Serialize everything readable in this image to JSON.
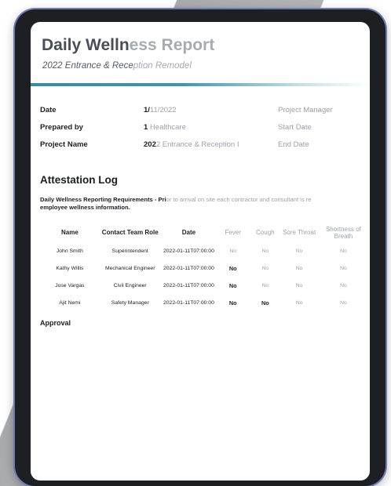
{
  "report": {
    "title_dark": "Daily Welln",
    "title_faded": "ess Report",
    "subtitle_dark": "2022 Entrance & Rece",
    "subtitle_faded": "ption Remodel"
  },
  "info": {
    "rows": [
      {
        "label": "Date",
        "value_dark": "1/",
        "value_faded": "11/2022",
        "label2": "Project Manager"
      },
      {
        "label": "Prepared by",
        "value_dark": "1 ",
        "value_faded": "Healthcare",
        "label2": "Start Date"
      },
      {
        "label": "Project Name",
        "value_dark": "202",
        "value_faded": "2 Entrance & Reception I",
        "label2": "End Date"
      }
    ]
  },
  "attestation": {
    "title": "Attestation Log",
    "req_bold": "Daily Wellness Reporting Requirements - Pri",
    "req_faded": "or to arrival on site each contractor and consultant is re",
    "req_line2": "employee wellness information."
  },
  "log_table": {
    "headers": [
      "Name",
      "Contact Team Role",
      "Date",
      "Fever",
      "Cough",
      "Sore Throat",
      "Shortness of Breath"
    ],
    "rows": [
      {
        "name": "John Smith",
        "role": "Superintendent",
        "date": "2022-01-11T07:00:00",
        "fever": "No",
        "cough": "No",
        "sore": "No",
        "breath": "No"
      },
      {
        "name": "Kathy Willis",
        "role": "Mechanical Engineer",
        "date": "2022-01-11T07:00:00",
        "fever": "No",
        "cough": "No",
        "sore": "No",
        "breath": "No"
      },
      {
        "name": "Jose Vargas",
        "role": "Civil Engineer",
        "date": "2022-01-11T07:00:00",
        "fever": "No",
        "cough": "No",
        "sore": "No",
        "breath": "No"
      },
      {
        "name": "Ajit Nemi",
        "role": "Safety Manager",
        "date": "2022-01-11T07:00:00",
        "fever": "No",
        "cough": "No",
        "sore": "No",
        "breath": "No"
      }
    ]
  },
  "approval": {
    "title": "Approval"
  },
  "colors": {
    "accent": "#2f8fa7",
    "tablet": "#1d1f23",
    "tablet_edge": "#6f7bb5"
  }
}
